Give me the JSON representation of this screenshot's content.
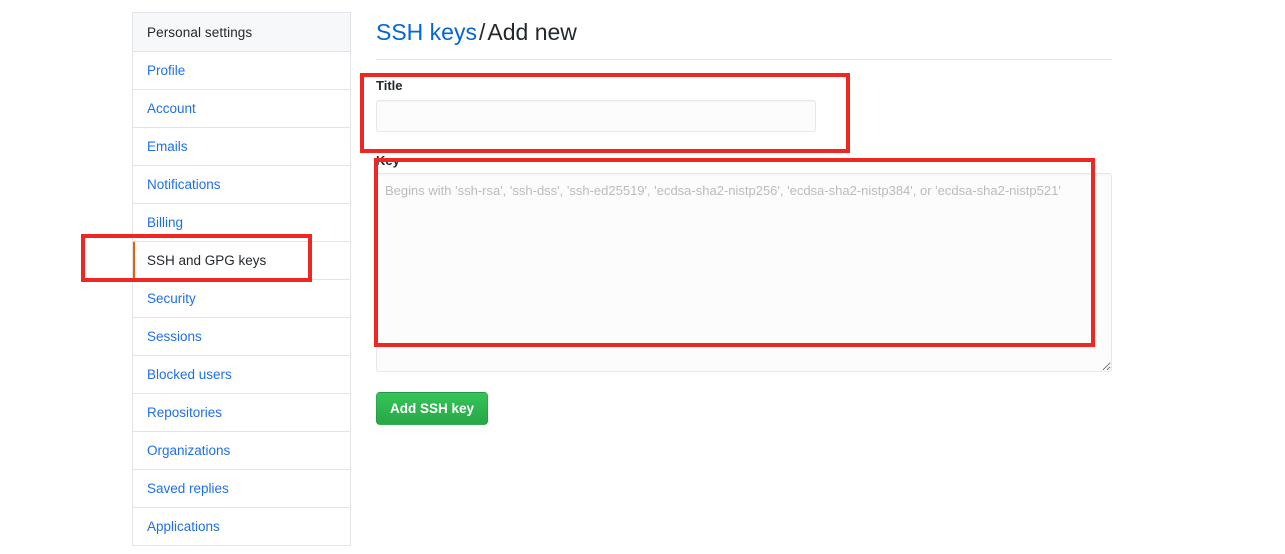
{
  "sidebar": {
    "header": "Personal settings",
    "items": [
      {
        "label": "Profile",
        "selected": false
      },
      {
        "label": "Account",
        "selected": false
      },
      {
        "label": "Emails",
        "selected": false
      },
      {
        "label": "Notifications",
        "selected": false
      },
      {
        "label": "Billing",
        "selected": false
      },
      {
        "label": "SSH and GPG keys",
        "selected": true
      },
      {
        "label": "Security",
        "selected": false
      },
      {
        "label": "Sessions",
        "selected": false
      },
      {
        "label": "Blocked users",
        "selected": false
      },
      {
        "label": "Repositories",
        "selected": false
      },
      {
        "label": "Organizations",
        "selected": false
      },
      {
        "label": "Saved replies",
        "selected": false
      },
      {
        "label": "Applications",
        "selected": false
      }
    ]
  },
  "main": {
    "breadcrumb_link": "SSH keys",
    "breadcrumb_separator": "/",
    "breadcrumb_current": "Add new",
    "title_field": {
      "label": "Title",
      "value": "",
      "placeholder": ""
    },
    "key_field": {
      "label": "Key",
      "value": "",
      "placeholder": "Begins with 'ssh-rsa', 'ssh-dss', 'ssh-ed25519', 'ecdsa-sha2-nistp256', 'ecdsa-sha2-nistp384', or 'ecdsa-sha2-nistp521'"
    },
    "submit_label": "Add SSH key"
  },
  "colors": {
    "link": "#0366d6",
    "sidebar_link": "#1f6feb",
    "selected_accent": "#e36209",
    "submit_green": "#28a745",
    "annotation_red": "#ee2722",
    "border": "#e1e4e8",
    "header_bg": "#f6f8fa"
  }
}
